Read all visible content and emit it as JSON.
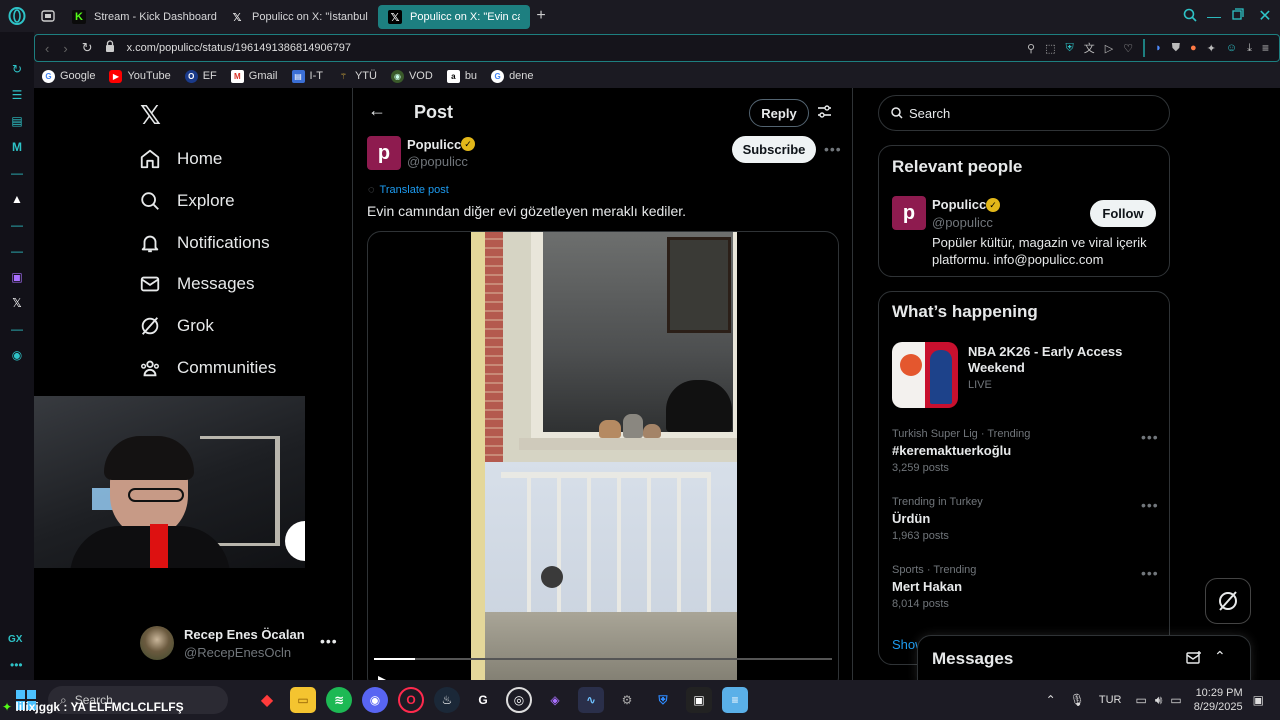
{
  "browser": {
    "tabs": [
      {
        "title": "Stream - Kick Dashboard",
        "icon": "kick-icon"
      },
      {
        "title": "Populicc on X: \"İstanbul E",
        "icon": "x-icon"
      },
      {
        "title": "Populicc on X: \"Evin cam",
        "icon": "x-icon"
      }
    ],
    "new_tab_label": "+",
    "url": "x.com/populicc/status/1961491386814906797",
    "bookmarks": [
      {
        "label": "Google",
        "icon": "google-icon"
      },
      {
        "label": "YouTube",
        "icon": "youtube-icon"
      },
      {
        "label": "EF",
        "icon": "ef-icon"
      },
      {
        "label": "Gmail",
        "icon": "gmail-icon"
      },
      {
        "label": "I-T",
        "icon": "folder-icon"
      },
      {
        "label": "YTÜ",
        "icon": "ytu-icon"
      },
      {
        "label": "VOD",
        "icon": "vod-icon"
      },
      {
        "label": "bu",
        "icon": "amazon-icon"
      },
      {
        "label": "dene",
        "icon": "google-icon"
      }
    ]
  },
  "x_nav": {
    "items": [
      {
        "label": "Home",
        "icon": "home-icon"
      },
      {
        "label": "Explore",
        "icon": "search-icon"
      },
      {
        "label": "Notifications",
        "icon": "bell-icon"
      },
      {
        "label": "Messages",
        "icon": "mail-icon"
      },
      {
        "label": "Grok",
        "icon": "grok-icon"
      },
      {
        "label": "Communities",
        "icon": "communities-icon"
      }
    ],
    "account_name": "Recep Enes Öcalan",
    "account_handle": "@RecepEnesOcln"
  },
  "post": {
    "header_title": "Post",
    "reply_label": "Reply",
    "author_name": "Populicc",
    "author_handle": "@populicc",
    "subscribe_label": "Subscribe",
    "translate_label": "Translate post",
    "text": "Evin camından diğer evi gözetleyen meraklı kediler.",
    "video_progress": 0.09
  },
  "right": {
    "search_placeholder": "Search",
    "relevant_title": "Relevant people",
    "person": {
      "name": "Populicc",
      "handle": "@populicc",
      "follow_label": "Follow",
      "bio": "Popüler kültür, magazin ve viral içerik platformu. info@populicc.com"
    },
    "happening_title": "What’s happening",
    "featured": {
      "title": "NBA 2K26 - Early Access Weekend",
      "status": "LIVE"
    },
    "trends": [
      {
        "meta": "Turkish Super Lig · Trending",
        "title": "#keremaktuerkoğlu",
        "count": "3,259 posts"
      },
      {
        "meta": "Trending in Turkey",
        "title": "Ürdün",
        "count": "1,963 posts"
      },
      {
        "meta": "Sports · Trending",
        "title": "Mert Hakan",
        "count": "8,014 posts"
      }
    ],
    "show_more": "Show more",
    "messages_drawer": "Messages"
  },
  "taskbar": {
    "search_placeholder": "Search",
    "stream_overlay_text": "lilixjggk : YA ELFMCLCLFLFŞ",
    "lang": "TUR",
    "time": "10:29 PM",
    "date": "8/29/2025"
  },
  "colors": {
    "accent": "#1d9bf0",
    "opera_teal": "#1d7f80",
    "verified": "#e2b719"
  }
}
